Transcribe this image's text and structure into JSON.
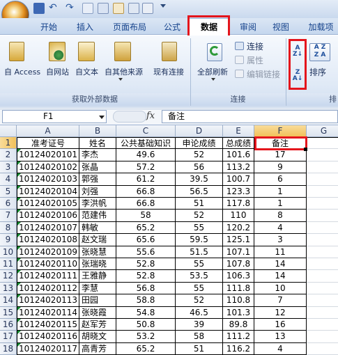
{
  "ribbon": {
    "tabs": [
      "开始",
      "插入",
      "页面布局",
      "公式",
      "数据",
      "审阅",
      "视图",
      "加载项"
    ],
    "external_group": {
      "buttons": [
        "自 Access",
        "自网站",
        "自文本",
        "自其他来源",
        "现有连接"
      ],
      "label": "获取外部数据"
    },
    "connections_group": {
      "refresh": "全部刷新",
      "items": [
        "连接",
        "属性",
        "编辑链接"
      ],
      "label": "连接"
    },
    "sort_group": {
      "sort_label": "排序",
      "label_partial": "排"
    }
  },
  "formula_bar": {
    "name_box": "F1",
    "fx": "fx",
    "formula": "备注"
  },
  "sheet": {
    "columns": [
      "A",
      "B",
      "C",
      "D",
      "E",
      "F",
      "G"
    ],
    "row_numbers": [
      "1",
      "2",
      "3",
      "4",
      "5",
      "6",
      "7",
      "8",
      "9",
      "10",
      "11",
      "12",
      "13",
      "14",
      "15",
      "16",
      "17",
      "18"
    ],
    "header": [
      "准考证号",
      "姓名",
      "公共基础知识",
      "申论成绩",
      "总成绩",
      "备注"
    ],
    "rows": [
      [
        "10124020101",
        "李杰",
        "49.6",
        "52",
        "101.6",
        "17"
      ],
      [
        "10124020102",
        "张晶",
        "57.2",
        "56",
        "113.2",
        "9"
      ],
      [
        "10124020103",
        "郭强",
        "61.2",
        "39.5",
        "100.7",
        "6"
      ],
      [
        "10124020104",
        "刘强",
        "66.8",
        "56.5",
        "123.3",
        "1"
      ],
      [
        "10124020105",
        "李洪帆",
        "66.8",
        "51",
        "117.8",
        "1"
      ],
      [
        "10124020106",
        "范建伟",
        "58",
        "52",
        "110",
        "8"
      ],
      [
        "10124020107",
        "韩敏",
        "65.2",
        "55",
        "120.2",
        "4"
      ],
      [
        "10124020108",
        "赵文瑞",
        "65.6",
        "59.5",
        "125.1",
        "3"
      ],
      [
        "10124020109",
        "张晓慧",
        "55.6",
        "51.5",
        "107.1",
        "11"
      ],
      [
        "10124020110",
        "张瑞晓",
        "52.8",
        "55",
        "107.8",
        "14"
      ],
      [
        "10124020111",
        "王雅静",
        "52.8",
        "53.5",
        "106.3",
        "14"
      ],
      [
        "10124020112",
        "李慧",
        "56.8",
        "55",
        "111.8",
        "10"
      ],
      [
        "10124020113",
        "田园",
        "58.8",
        "52",
        "110.8",
        "7"
      ],
      [
        "10124020114",
        "张晓霞",
        "54.8",
        "46.5",
        "101.3",
        "12"
      ],
      [
        "10124020115",
        "赵军芳",
        "50.8",
        "39",
        "89.8",
        "16"
      ],
      [
        "10124020116",
        "胡晓文",
        "53.2",
        "58",
        "111.2",
        "13"
      ],
      [
        "10124020117",
        "高青芳",
        "65.2",
        "51",
        "116.2",
        "4"
      ]
    ]
  }
}
